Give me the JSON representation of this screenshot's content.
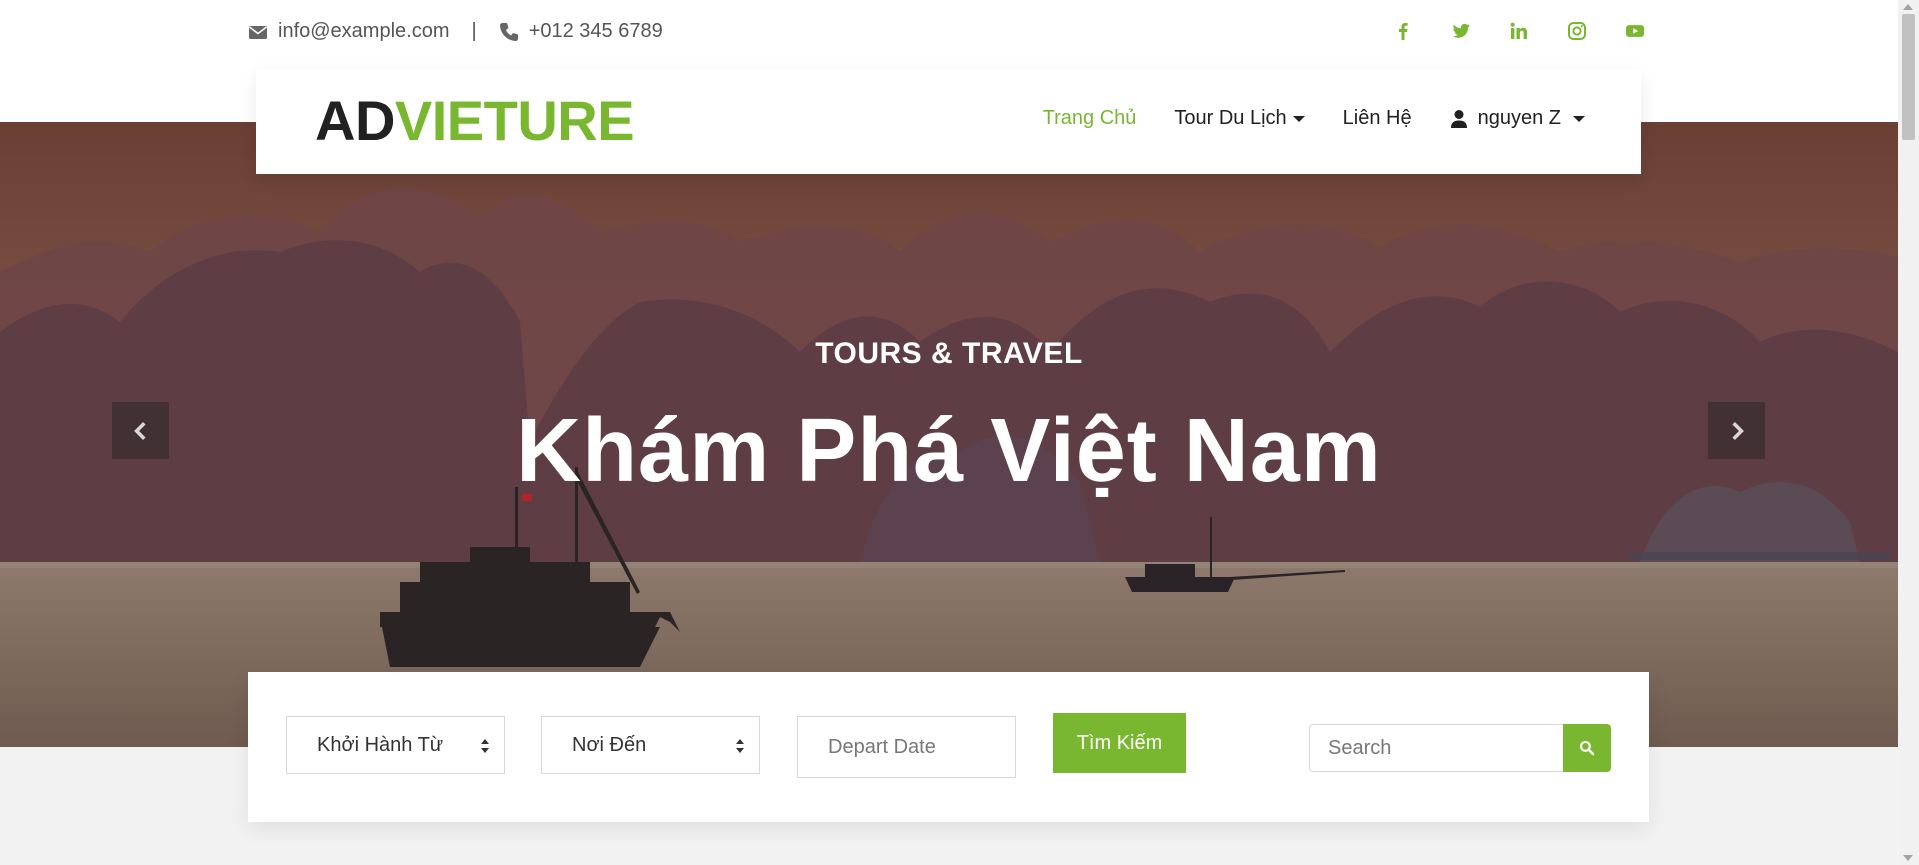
{
  "topbar": {
    "email": "info@example.com",
    "separator": "|",
    "phone": "+012 345 6789",
    "socials": [
      "facebook-icon",
      "twitter-icon",
      "linkedin-icon",
      "instagram-icon",
      "youtube-icon"
    ]
  },
  "navbar": {
    "brand_part1": "AD",
    "brand_part2": "VIETURE",
    "items": [
      {
        "label": "Trang Chủ",
        "active": true
      },
      {
        "label": "Tour Du Lịch",
        "dropdown": true
      },
      {
        "label": "Liên Hệ"
      },
      {
        "label": "nguyen Z",
        "dropdown": true,
        "icon": "user-icon"
      }
    ]
  },
  "hero": {
    "subtitle": "TOURS & TRAVEL",
    "title": "Khám Phá Việt Nam"
  },
  "search": {
    "from_select": "Khởi Hành Từ",
    "to_select": "Nơi Đến",
    "date_placeholder": "Depart Date",
    "submit_label": "Tìm Kiếm",
    "keyword_placeholder": "Search"
  },
  "colors": {
    "accent": "#7ab730",
    "text": "#212121"
  }
}
